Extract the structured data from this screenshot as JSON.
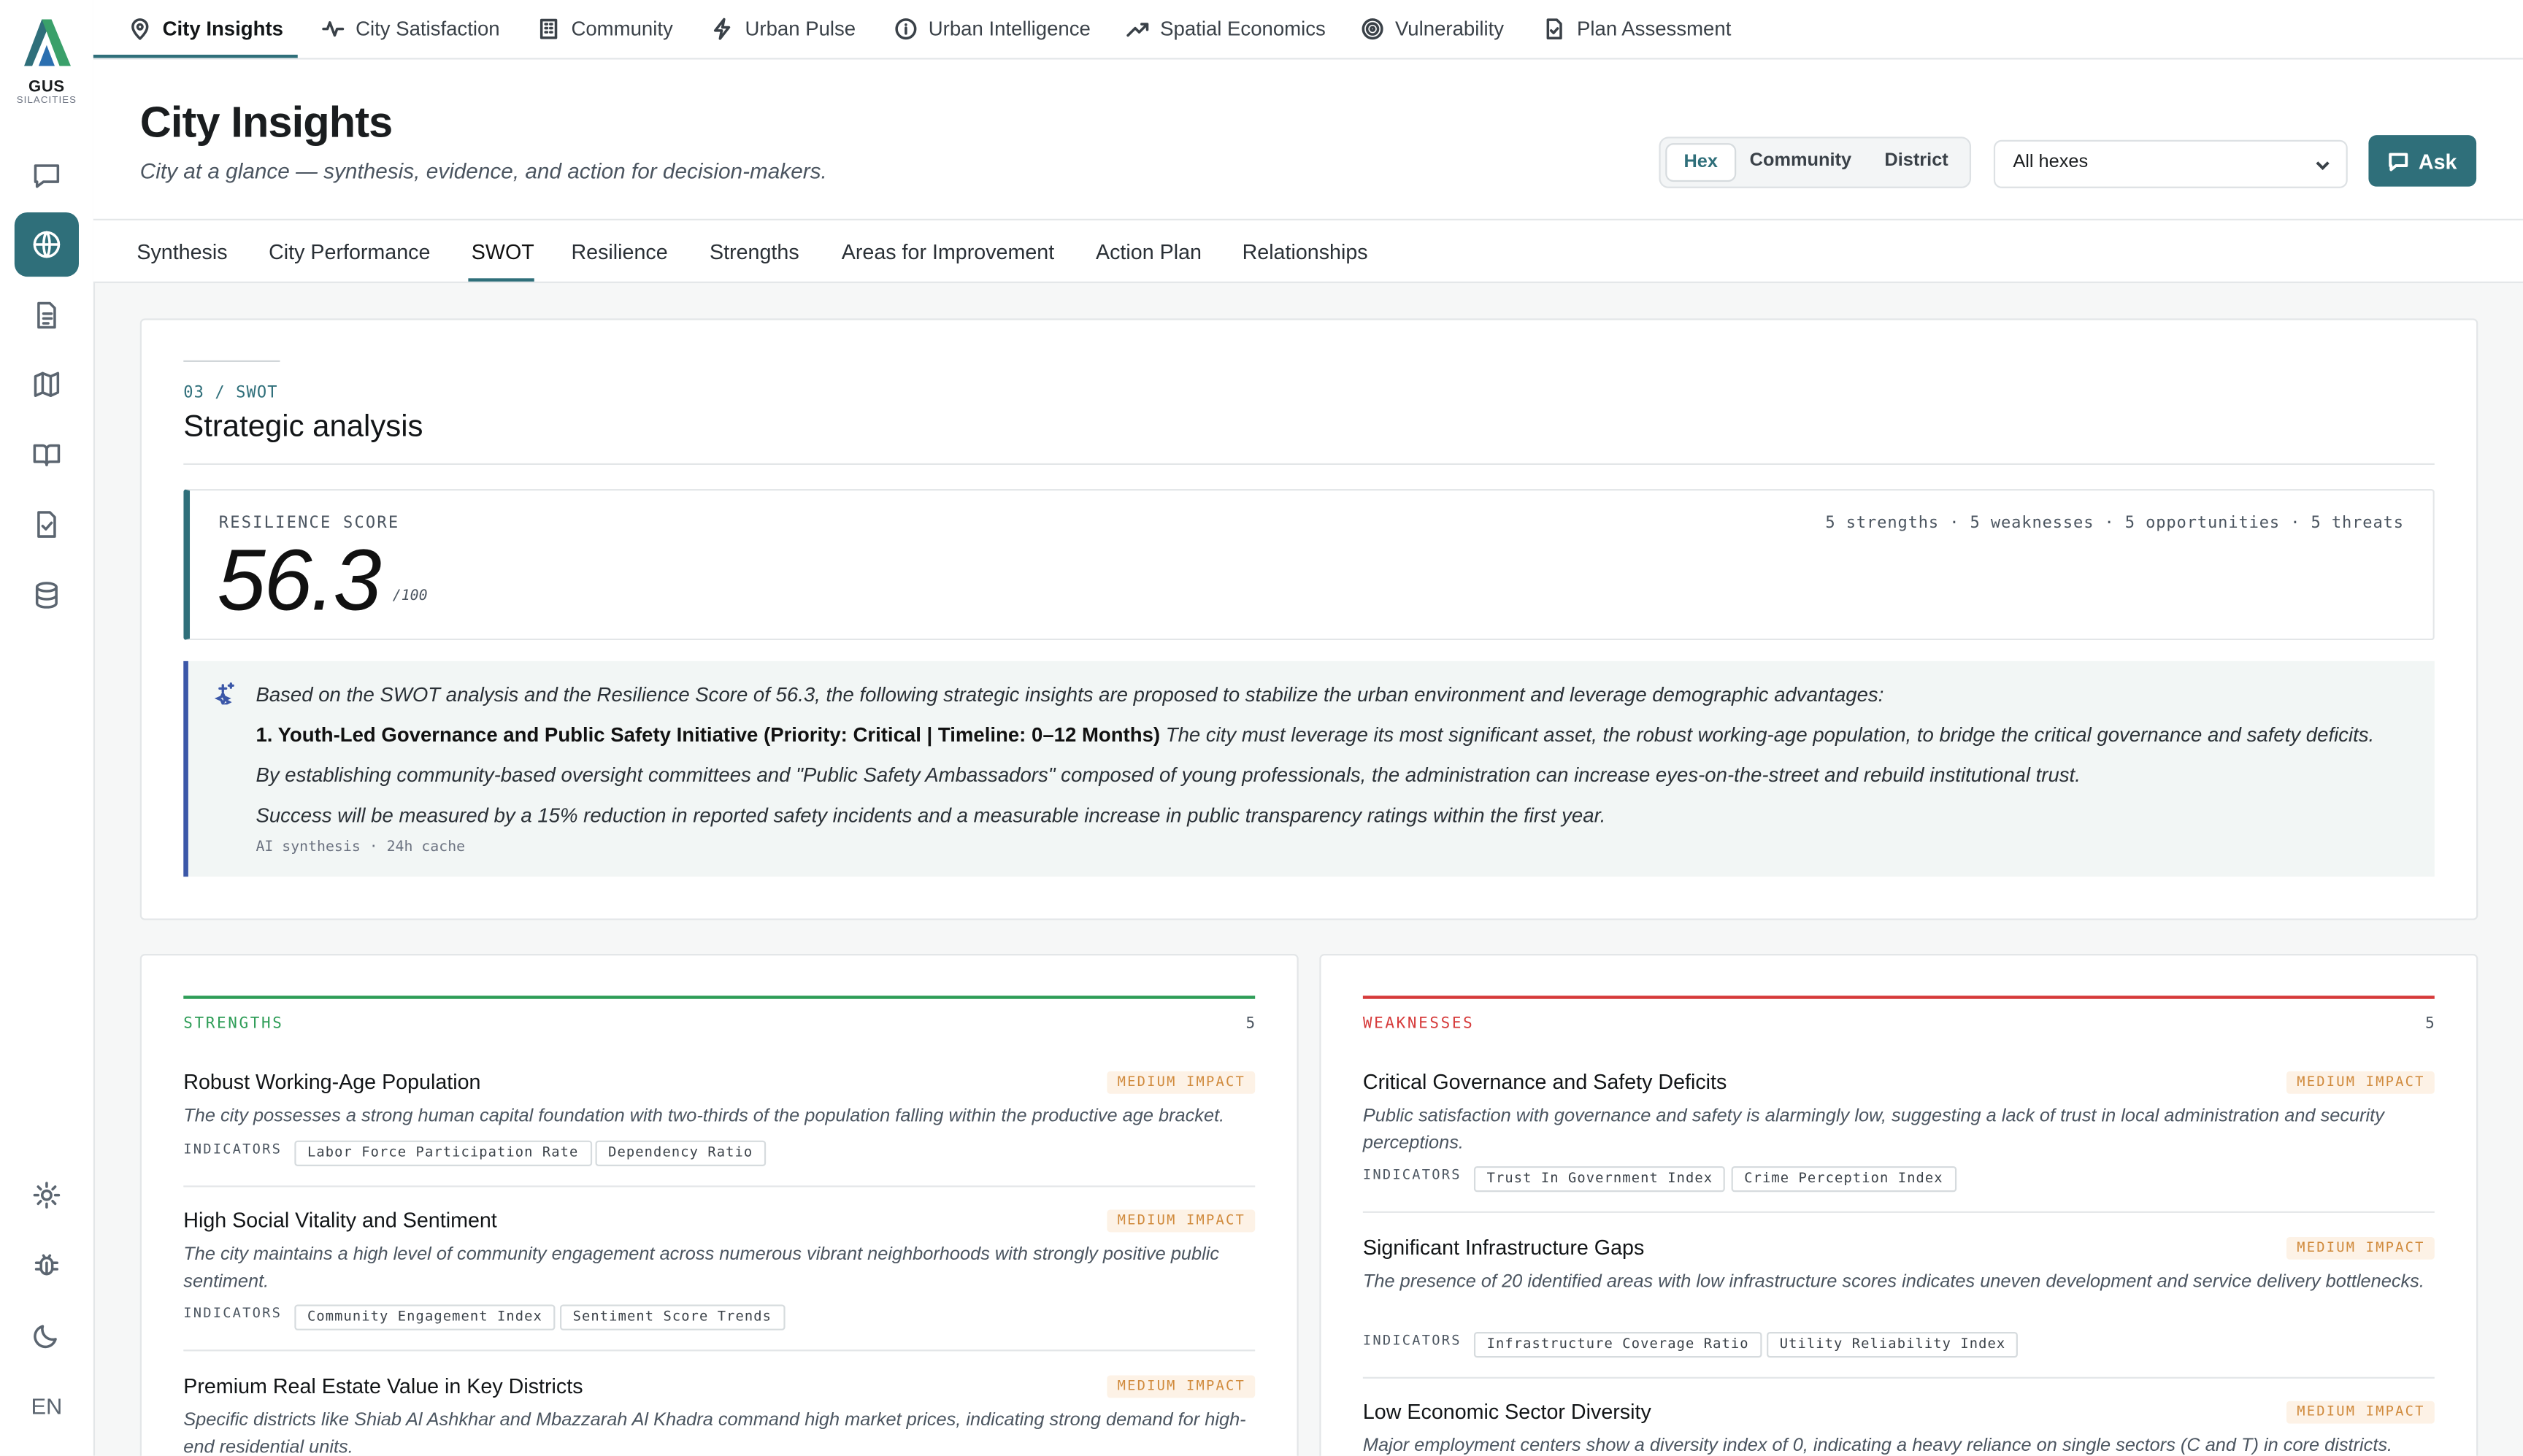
{
  "brand": {
    "name": "GUS",
    "sub": "SILACITIES"
  },
  "top_nav": [
    "City Insights",
    "City Satisfaction",
    "Community",
    "Urban Pulse",
    "Urban Intelligence",
    "Spatial Economics",
    "Vulnerability",
    "Plan Assessment"
  ],
  "header": {
    "title": "City Insights",
    "subtitle": "City at a glance — synthesis, evidence, and action for decision-makers.",
    "scope": [
      "Hex",
      "Community",
      "District"
    ],
    "select_value": "All hexes",
    "ask": "Ask"
  },
  "tabs": [
    "Synthesis",
    "City Performance",
    "SWOT",
    "Resilience",
    "Strengths",
    "Areas for Improvement",
    "Action Plan",
    "Relationships"
  ],
  "rail_lang": "EN",
  "swot": {
    "eyebrow": "03 / SWOT",
    "title": "Strategic analysis",
    "score_label": "RESILIENCE SCORE",
    "score": "56.3",
    "score_max": "/100",
    "counts": "5 strengths · 5 weaknesses · 5 opportunities · 5 threats",
    "insight": {
      "intro": "Based on the SWOT analysis and the Resilience Score of 56.3, the following strategic insights are proposed to stabilize the urban environment and leverage demographic advantages:",
      "point_title": "1. Youth-Led Governance and Public Safety Initiative (Priority: Critical | Timeline: 0–12 Months)",
      "point_text": " The city must leverage its most significant asset, the robust working-age population, to bridge the critical governance and safety deficits.",
      "line3": "By establishing community-based oversight committees and \"Public Safety Ambassadors\" composed of young professionals, the administration can increase eyes-on-the-street and rebuild institutional trust.",
      "line4": "Success will be measured by a 15% reduction in reported safety incidents and a measurable increase in public transparency ratings within the first year.",
      "footer": "AI synthesis · 24h cache"
    }
  },
  "strengths": {
    "heading": "STRENGTHS",
    "count": "5",
    "indicators_label": "INDICATORS",
    "items": [
      {
        "title": "Robust Working-Age Population",
        "impact": "MEDIUM IMPACT",
        "desc": "The city possesses a strong human capital foundation with two-thirds of the population falling within the productive age bracket.",
        "indicators": [
          "Labor Force Participation Rate",
          "Dependency Ratio"
        ]
      },
      {
        "title": "High Social Vitality and Sentiment",
        "impact": "MEDIUM IMPACT",
        "desc": "The city maintains a high level of community engagement across numerous vibrant neighborhoods with strongly positive public sentiment.",
        "indicators": [
          "Community Engagement Index",
          "Sentiment Score Trends"
        ]
      },
      {
        "title": "Premium Real Estate Value in Key Districts",
        "impact": "MEDIUM IMPACT",
        "desc": "Specific districts like Shiab Al Ashkhar and Mbazzarah Al Khadra command high market prices, indicating strong demand for high-end residential units."
      }
    ]
  },
  "weaknesses": {
    "heading": "WEAKNESSES",
    "count": "5",
    "indicators_label": "INDICATORS",
    "items": [
      {
        "title": "Critical Governance and Safety Deficits",
        "impact": "MEDIUM IMPACT",
        "desc": "Public satisfaction with governance and safety is alarmingly low, suggesting a lack of trust in local administration and security perceptions.",
        "indicators": [
          "Trust In Government Index",
          "Crime Perception Index"
        ]
      },
      {
        "title": "Significant Infrastructure Gaps",
        "impact": "MEDIUM IMPACT",
        "desc": "The presence of 20 identified areas with low infrastructure scores indicates uneven development and service delivery bottlenecks.",
        "indicators": [
          "Infrastructure Coverage Ratio",
          "Utility Reliability Index"
        ]
      },
      {
        "title": "Low Economic Sector Diversity",
        "impact": "MEDIUM IMPACT",
        "desc": "Major employment centers show a diversity index of 0, indicating a heavy reliance on single sectors (C and T) in core districts."
      }
    ]
  },
  "colors": {
    "accent": "#2f6f7a",
    "strengths": "#2e9d57",
    "weaknesses": "#d63a3a",
    "impact": "#d08a3c",
    "insight_rule": "#3b57a8"
  }
}
